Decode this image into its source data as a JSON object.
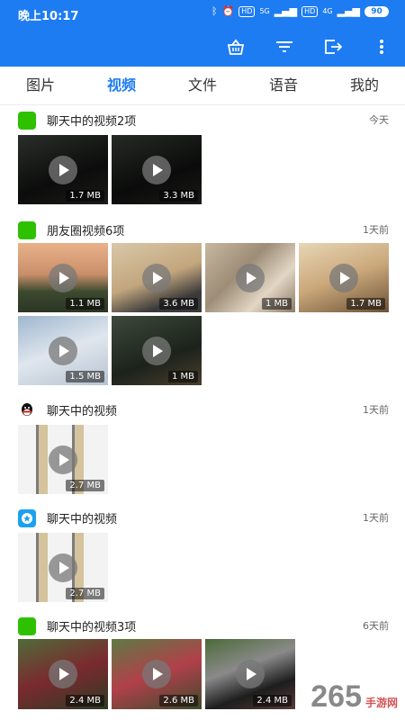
{
  "status_bar": {
    "time": "晚上10:17",
    "signal1": "5G",
    "signal2": "4G",
    "battery": "90",
    "hd1": "HD",
    "hd2": "HD"
  },
  "tabs": [
    {
      "label": "图片"
    },
    {
      "label": "视频",
      "active": true
    },
    {
      "label": "文件"
    },
    {
      "label": "语音"
    },
    {
      "label": "我的"
    }
  ],
  "sections": [
    {
      "title": "聊天中的视频2项",
      "time": "今天",
      "app_icon": "wechat-icon",
      "thumbs": [
        {
          "size": "1.7 MB"
        },
        {
          "size": "3.3 MB"
        }
      ]
    },
    {
      "title": "朋友圈视频6项",
      "time": "1天前",
      "app_icon": "wechat-icon",
      "thumbs": [
        {
          "size": "1.1 MB"
        },
        {
          "size": "3.6 MB"
        },
        {
          "size": "1 MB"
        },
        {
          "size": "1.7 MB"
        },
        {
          "size": "1.5 MB"
        },
        {
          "size": "1 MB"
        }
      ]
    },
    {
      "title": "聊天中的视频",
      "time": "1天前",
      "app_icon": "qq-icon",
      "thumbs": [
        {
          "size": "2.7 MB"
        }
      ]
    },
    {
      "title": "聊天中的视频",
      "time": "1天前",
      "app_icon": "star-app-icon",
      "thumbs": [
        {
          "size": "2.7 MB"
        }
      ]
    },
    {
      "title": "聊天中的视频3项",
      "time": "6天前",
      "app_icon": "wechat-icon",
      "thumbs": [
        {
          "size": "2.4 MB"
        },
        {
          "size": "2.6 MB"
        },
        {
          "size": "2.4 MB"
        }
      ]
    }
  ],
  "watermark": {
    "number": "265",
    "text": "手游网"
  },
  "colors": {
    "accent": "#1e7cf2",
    "wechat": "#2dc100"
  }
}
